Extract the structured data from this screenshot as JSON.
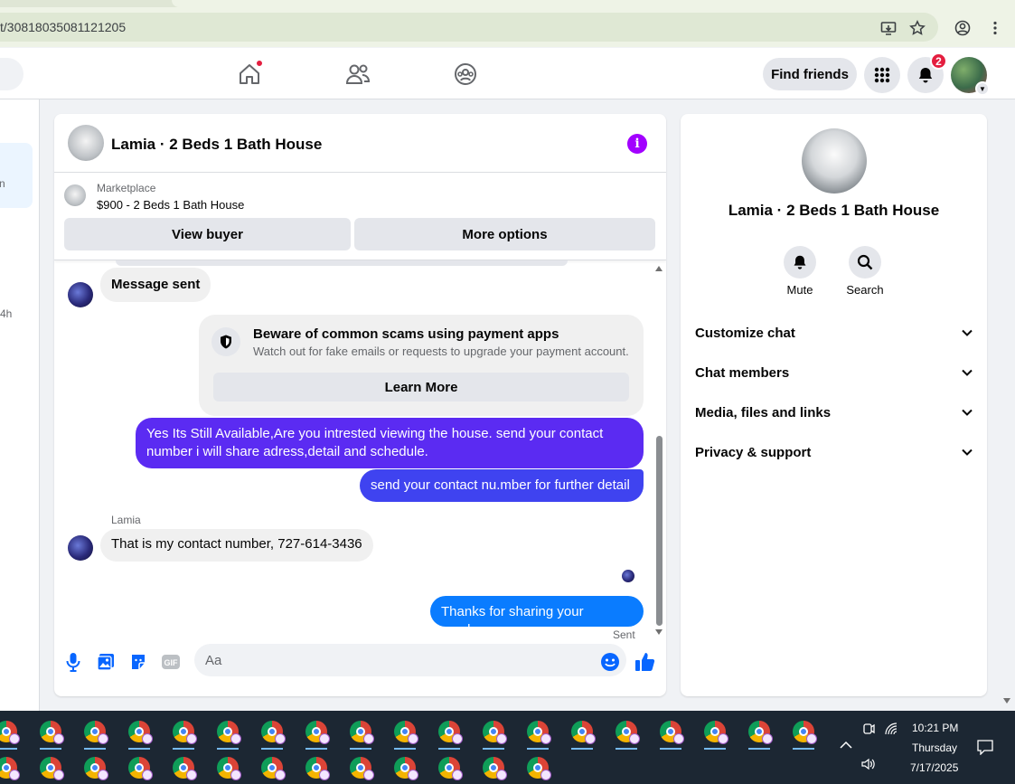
{
  "browser": {
    "url": "t/30818035081121205"
  },
  "header": {
    "find_friends": "Find friends",
    "notification_count": "2",
    "icons": [
      "home-icon",
      "friends-icon",
      "groups-icon",
      "menu-grid-icon",
      "bell-icon"
    ]
  },
  "left": {
    "selected_snippet": "n",
    "time": "4h"
  },
  "chat": {
    "title": "Lamia · 2 Beds 1 Bath House",
    "marketplace_label": "Marketplace",
    "listing": "$900 - 2 Beds 1 Bath House",
    "view_buyer": "View buyer",
    "more_options": "More options",
    "messages": {
      "m1": "Message sent",
      "scam_title": "Beware of common scams using payment apps",
      "scam_sub": "Watch out for fake emails or requests to upgrade your payment account.",
      "learn_more": "Learn More",
      "out1": "Yes Its Still Available,Are you intrested viewing the house. send your contact number i will share adress,detail and schedule.",
      "out2": "send your contact nu.mber for further detail",
      "sender_name": "Lamia",
      "in2": "That is my contact number, 727-614-3436",
      "out3": "Thanks for sharing your number",
      "sent_status": "Sent"
    },
    "composer_placeholder": "Aa"
  },
  "right": {
    "title": "Lamia · 2 Beds 1 Bath House",
    "mute": "Mute",
    "search": "Search",
    "rows": [
      "Customize chat",
      "Chat members",
      "Media, files and links",
      "Privacy & support"
    ]
  },
  "taskbar": {
    "time": "10:21 PM",
    "day": "Thursday",
    "date": "7/17/2025"
  },
  "colors": {
    "outgoing_gradient_top": "#5b2bf2",
    "outgoing_gradient_bottom": "#0a7cff",
    "accent_info": "#a200ff",
    "badge": "#e41e3f"
  }
}
